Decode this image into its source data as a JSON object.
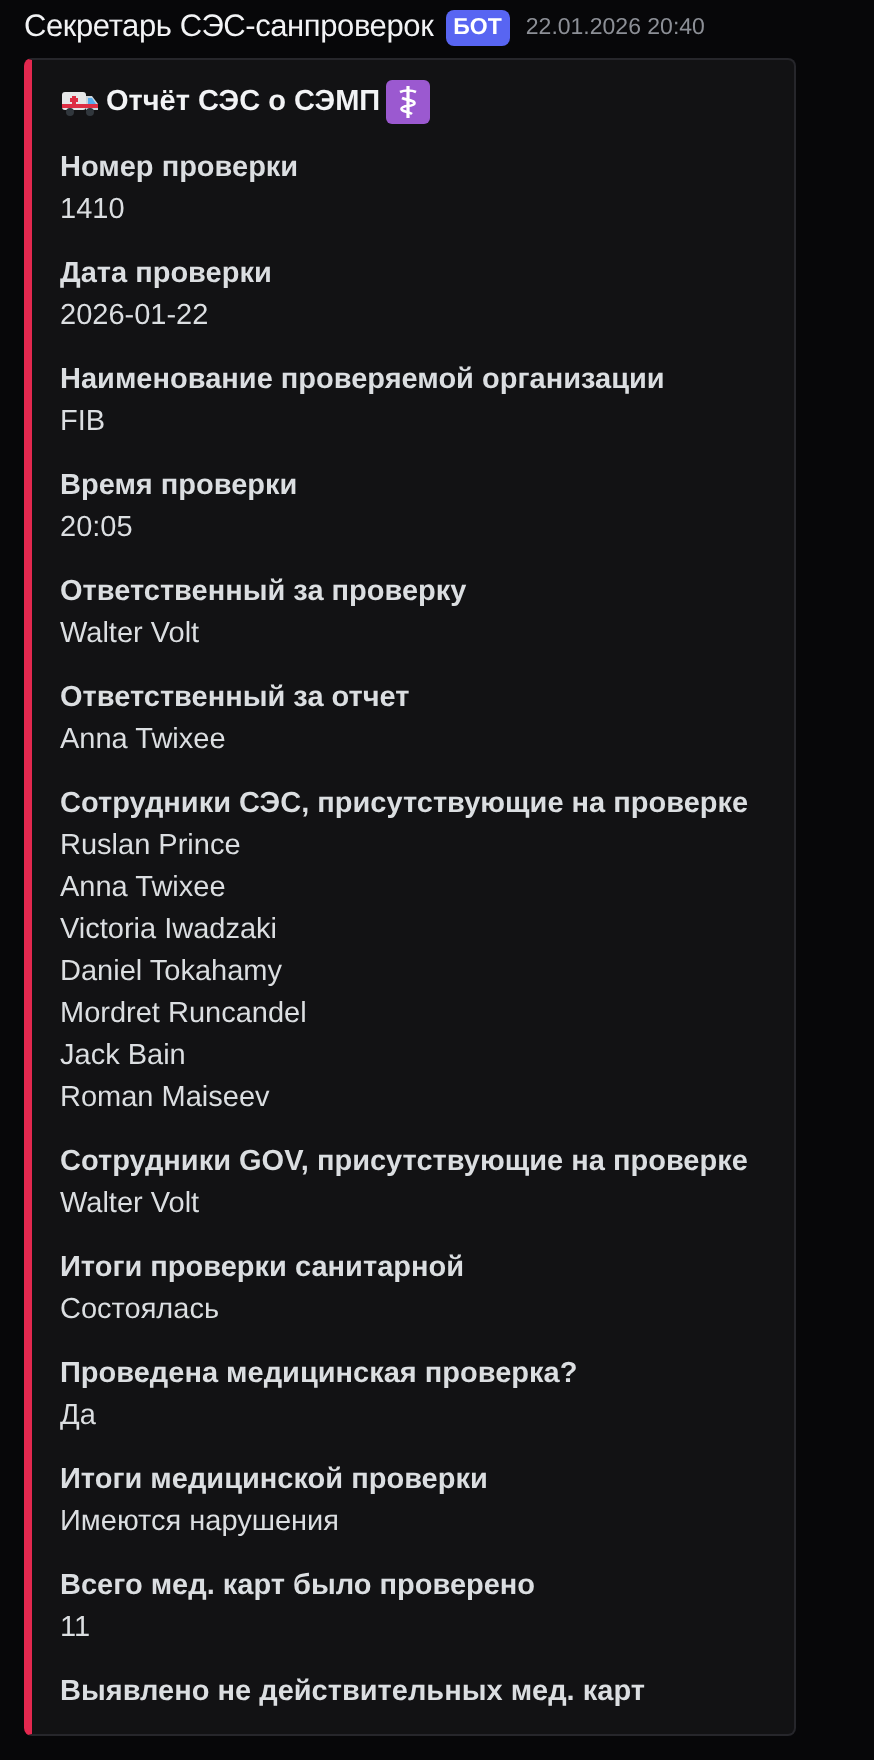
{
  "message": {
    "author": "Секретарь СЭС-санпроверок",
    "badge": "БОТ",
    "timestamp": "22.01.2026 20:40"
  },
  "embed": {
    "title": "Отчёт СЭС о СЭМП",
    "fields": [
      {
        "name": "Номер проверки",
        "value": [
          "1410"
        ]
      },
      {
        "name": "Дата проверки",
        "value": [
          "2026-01-22"
        ]
      },
      {
        "name": "Наименование проверяемой организации",
        "value": [
          "FIB"
        ]
      },
      {
        "name": "Время проверки",
        "value": [
          "20:05"
        ]
      },
      {
        "name": "Ответственный за проверку",
        "value": [
          "Walter Volt"
        ]
      },
      {
        "name": "Ответственный за отчет",
        "value": [
          "Anna Twixee"
        ]
      },
      {
        "name": "Сотрудники СЭС, присутствующие на проверке",
        "value": [
          "Ruslan Prince",
          "Anna Twixee",
          "Victoria Iwadzaki",
          "Daniel Tokahamy",
          "Mordret Runcandel",
          "Jack Bain",
          "Roman Maiseev"
        ]
      },
      {
        "name": "Сотрудники GOV, присутствующие на проверке",
        "value": [
          "Walter Volt"
        ]
      },
      {
        "name": "Итоги проверки санитарной",
        "value": [
          "Состоялась"
        ]
      },
      {
        "name": "Проведена медицинская проверка?",
        "value": [
          "Да"
        ]
      },
      {
        "name": "Итоги медицинской проверки",
        "value": [
          "Имеются нарушения"
        ]
      },
      {
        "name": "Всего мед. карт было проверено",
        "value": [
          "11"
        ]
      },
      {
        "name": "Выявлено не действительных мед. карт"
      }
    ]
  }
}
